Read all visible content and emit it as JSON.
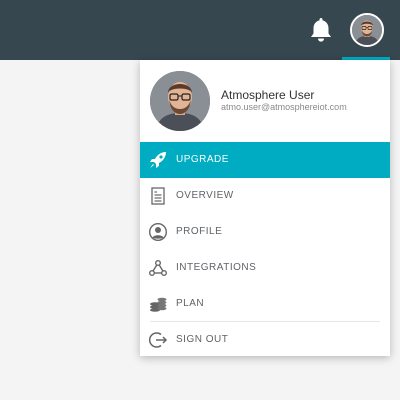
{
  "user": {
    "name": "Atmosphere User",
    "email": "atmo.user@atmosphereiot.com"
  },
  "header": {
    "notification_icon": "bell-icon",
    "avatar_icon": "avatar-image"
  },
  "menu": {
    "items": [
      {
        "label": "UPGRADE",
        "icon": "rocket-icon",
        "active": true
      },
      {
        "label": "OVERVIEW",
        "icon": "document-icon",
        "active": false
      },
      {
        "label": "PROFILE",
        "icon": "user-icon",
        "active": false
      },
      {
        "label": "INTEGRATIONS",
        "icon": "webhook-icon",
        "active": false
      },
      {
        "label": "PLAN",
        "icon": "coins-icon",
        "active": false
      },
      {
        "label": "SIGN OUT",
        "icon": "sign-out-icon",
        "active": false
      }
    ]
  },
  "colors": {
    "topbar": "#37474f",
    "accent": "#00acc1",
    "background": "#f4f4f4",
    "menu_text": "#5f6368"
  }
}
